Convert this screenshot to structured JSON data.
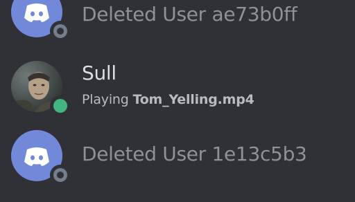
{
  "colors": {
    "background": "#2f3136",
    "blurple": "#7289da",
    "offline_status": "#747f8d",
    "online_status": "#43b581",
    "muted_text": "#8e9297",
    "primary_text": "#dcddde",
    "secondary_text": "#b9bbbe"
  },
  "members": [
    {
      "name": "Deleted User ae73b0ff",
      "avatar": "discord-default-avatar",
      "status": "offline"
    },
    {
      "name": "Sull",
      "avatar": "user-photo-avatar",
      "status": "online",
      "activity_prefix": "Playing",
      "activity_name": "Tom_Yelling.mp4"
    },
    {
      "name": "Deleted User 1e13c5b3",
      "avatar": "discord-default-avatar",
      "status": "offline"
    }
  ]
}
